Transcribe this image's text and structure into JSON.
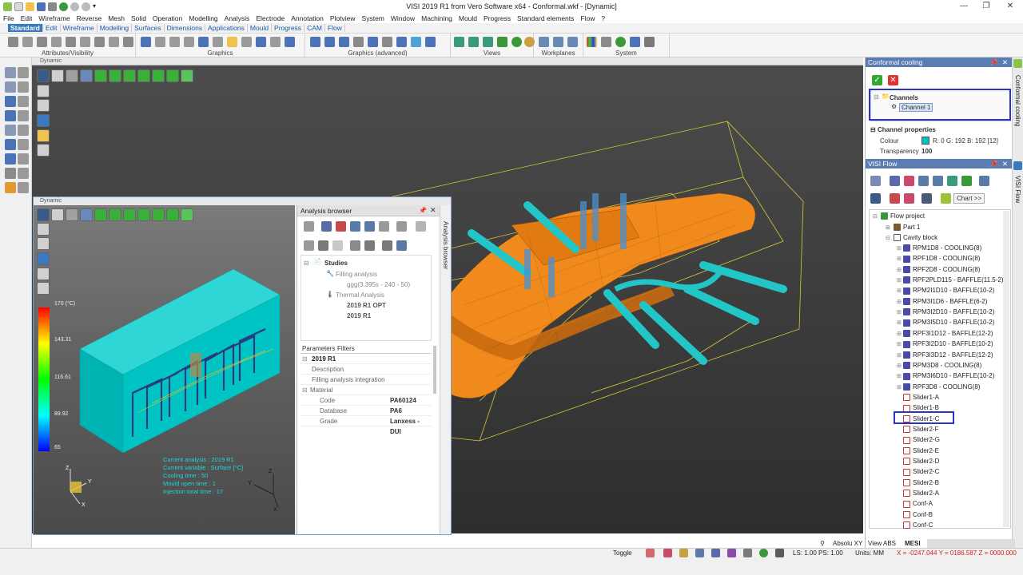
{
  "window": {
    "title": "VISI 2019 R1 from Vero Software x64 - Conformal.wkf - [Dynamic]",
    "minimize": "—",
    "restore": "❐",
    "close": "✕"
  },
  "menu": [
    "File",
    "Edit",
    "Wireframe",
    "Reverse",
    "Mesh",
    "Solid",
    "Operation",
    "Modelling",
    "Analysis",
    "Electrode",
    "Annotation",
    "Plotview",
    "System",
    "Window",
    "Machining",
    "Mould",
    "Progress",
    "Standard elements",
    "Flow",
    "?"
  ],
  "ribbon_tabs": [
    "Standard",
    "Edit",
    "Wireframe",
    "Modelling",
    "Surfaces",
    "Dimensions",
    "Applications",
    "Mould",
    "Progress",
    "CAM",
    "Flow"
  ],
  "ribbon_groups": [
    "Attributes/Visibility",
    "Graphics",
    "Graphics (advanced)",
    "Views",
    "Workplanes",
    "System"
  ],
  "viewport": {
    "header": "Dynamic"
  },
  "child_window": {
    "header": "Dynamic",
    "legend": {
      "max": "170 (°C)",
      "v2": "143.31",
      "v3": "116.61",
      "v4": "89.92",
      "min": "65"
    },
    "overlay_lines": [
      "Current analysis : 2019 R1",
      "Current variable : Surface [°C]",
      "Cooling time : 50",
      "Mould open time : 1",
      "Injection total time : 17"
    ]
  },
  "analysis_browser": {
    "title": "Analysis browser",
    "side_label": "Analysis browser",
    "tree": {
      "studies": "Studies",
      "filling": "Filling analysis",
      "filling_child": "ggg(3.395s - 240 - 50)",
      "thermal": "Thermal Analysis",
      "opt": "2019 R1 OPT",
      "r1": "2019 R1"
    },
    "tabs": {
      "parameters": "Parameters",
      "filters": "Filters"
    },
    "section": "2019 R1",
    "rows": {
      "description": "Description",
      "filling_integration": "Filling analysis integration",
      "material": "Material",
      "code_k": "Code",
      "code_v": "PA60124",
      "db_k": "Database",
      "db_v": "PA6",
      "grade_k": "Grade",
      "grade_v": "Lanxess - DUI"
    }
  },
  "conformal_cooling": {
    "title": "Conformal cooling",
    "side_label": "Conformal cooling",
    "channels": "Channels",
    "channel1": "Channel 1",
    "props_title": "Channel properties",
    "colour_k": "Colour",
    "colour_v": "R: 0 G: 192 B: 192 [12]",
    "transparency_k": "Transparency",
    "transparency_v": "100"
  },
  "visi_flow": {
    "title": "VISI Flow",
    "side_label": "VISI Flow",
    "chart_button": "Chart >>",
    "project": "Flow project",
    "part": "Part 1",
    "cavity": "Cavity block",
    "items": [
      "RPM1D8 - COOLING(8)",
      "RPF1D8 - COOLING(8)",
      "RPF2D8 - COOLING(8)",
      "RPF2PLD115 - BAFFLE(11.5-2)",
      "RPM2I1D10 - BAFFLE(10-2)",
      "RPM3I1D6 - BAFFLE(6-2)",
      "RPM3I2D10 - BAFFLE(10-2)",
      "RPM3I5D10 - BAFFLE(10-2)",
      "RPF3I1D12 - BAFFLE(12-2)",
      "RPF3I2D10 - BAFFLE(10-2)",
      "RPF3I3D12 - BAFFLE(12-2)",
      "RPM3D8 - COOLING(8)",
      "RPM3I6D10 - BAFFLE(10-2)",
      "RPF3D8 - COOLING(8)"
    ],
    "sliders": [
      "Slider1-A",
      "Slider1-B",
      "Slider1-C",
      "Slider2-F",
      "Slider2-G",
      "Slider2-E",
      "Slider2-D",
      "Slider2-C",
      "Slider2-B",
      "Slider2-A",
      "Conf-A",
      "Conf-B",
      "Conf-C"
    ]
  },
  "status": {
    "absolu": "Absolu XY",
    "view": "View ABS",
    "mesi": "MESI",
    "toggle": "Toggle",
    "ls": "LS: 1.00 PS: 1.00",
    "units": "Units: MM",
    "coords": "X = -0247.044 Y = 0186.587 Z = 0000.000"
  },
  "colors": {
    "accent": "#3b78c2",
    "panel_title": "#5b7db1",
    "highlight_box": "#2a34c9",
    "mesh_orange": "#f08a1c",
    "cooling_cyan": "#22c6c6",
    "block_cyan": "#00c4c4"
  }
}
